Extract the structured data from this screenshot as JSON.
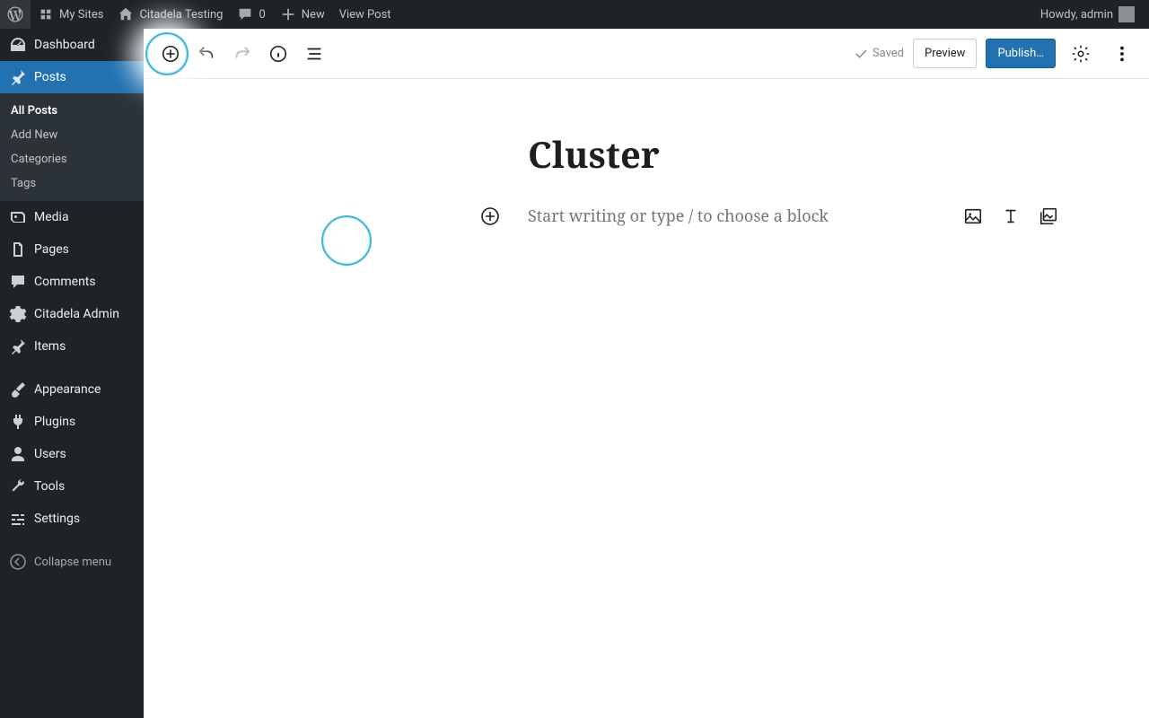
{
  "adminbar": {
    "my_sites": "My Sites",
    "site_name": "Citadela Testing",
    "comments_count": "0",
    "new": "New",
    "view_post": "View Post",
    "howdy": "Howdy, admin"
  },
  "sidebar": {
    "dashboard": "Dashboard",
    "posts": "Posts",
    "posts_submenu": {
      "all_posts": "All Posts",
      "add_new": "Add New",
      "categories": "Categories",
      "tags": "Tags"
    },
    "media": "Media",
    "pages": "Pages",
    "comments": "Comments",
    "citadela_admin": "Citadela Admin",
    "items": "Items",
    "appearance": "Appearance",
    "plugins": "Plugins",
    "users": "Users",
    "tools": "Tools",
    "settings": "Settings",
    "collapse": "Collapse menu"
  },
  "editor": {
    "saved": "Saved",
    "preview": "Preview",
    "publish": "Publish…",
    "post_title": "Cluster",
    "placeholder": "Start writing or type / to choose a block"
  }
}
